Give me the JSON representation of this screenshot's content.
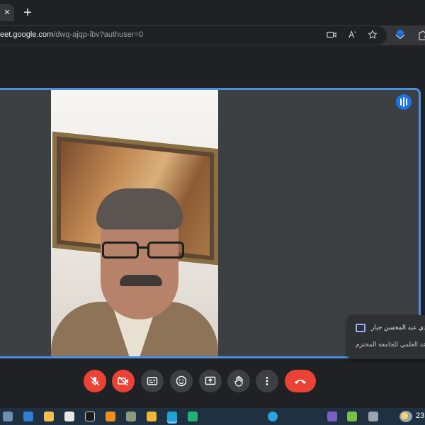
{
  "browser": {
    "tab_close_label": "×",
    "new_tab_label": "+",
    "url_host": "eet.google.com",
    "url_path": "/dwq-ajqp-ibv?authuser=0"
  },
  "meeting": {
    "toast_sender": "دي عبد المحسن جبار",
    "toast_message": "اعد العلمي للجامعة المحترم"
  },
  "taskbar": {
    "clock": "23"
  },
  "colors": {
    "accent_blue": "#4a8fe0",
    "end_call_red": "#ea4335",
    "control_gray": "#3c4043",
    "background": "#202124"
  }
}
